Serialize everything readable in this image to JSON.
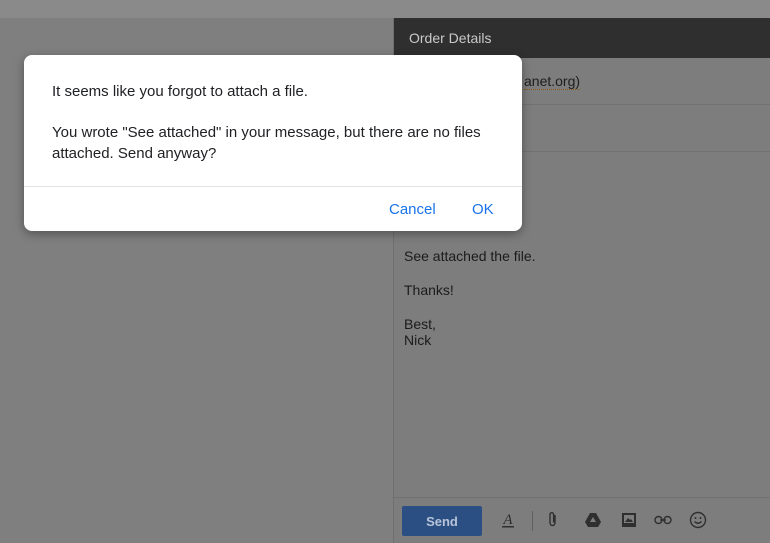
{
  "compose": {
    "title": "Order Details",
    "recipient_visible": "anet.org)",
    "body_lines": [
      "See attached the file.",
      "Thanks!",
      "Best,",
      "Nick"
    ],
    "toolbar": {
      "send_label": "Send",
      "icons": [
        "format-text-icon",
        "attach-icon",
        "drive-icon",
        "photo-icon",
        "link-icon",
        "emoji-icon"
      ]
    }
  },
  "dialog": {
    "title": "It seems like you forgot to attach a file.",
    "message": "You wrote \"See attached\" in your message, but there are no files attached. Send anyway?",
    "cancel_label": "Cancel",
    "ok_label": "OK"
  },
  "colors": {
    "accent": "#1a73e8",
    "overlay": "#7f7f7f",
    "compose_header": "#2f2f2f",
    "send_button": "#2c4f83"
  }
}
